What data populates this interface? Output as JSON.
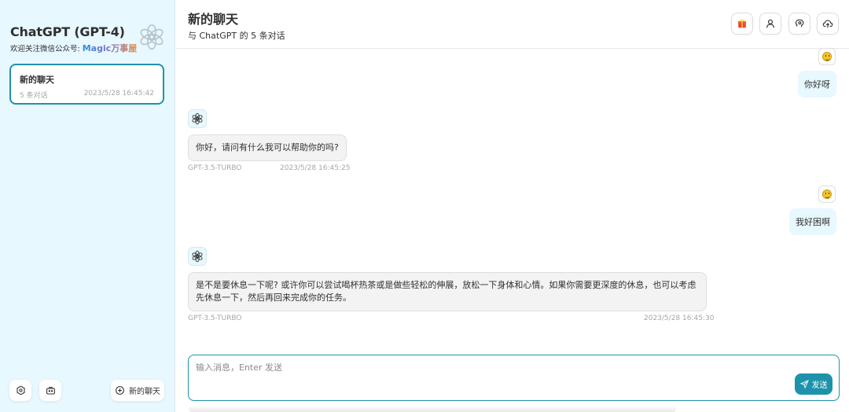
{
  "sidebar": {
    "title": "ChatGPT (GPT-4)",
    "subtitle_prefix": "欢迎关注微信公众号:",
    "subtitle_brand": "Magic万事屋",
    "chats": [
      {
        "title": "新的聊天",
        "count": "5 条对话",
        "time": "2023/5/28 16:45:42"
      }
    ],
    "new_chat_label": "新的聊天"
  },
  "header": {
    "title": "新的聊天",
    "subtitle": "与 ChatGPT 的 5 条对话"
  },
  "messages": [
    {
      "role": "user",
      "text": "你好呀"
    },
    {
      "role": "bot",
      "text": "你好，请问有什么我可以帮助你的吗?",
      "model": "GPT-3.5-TURBO",
      "time": "2023/5/28 16:45:25"
    },
    {
      "role": "user",
      "text": "我好困啊"
    },
    {
      "role": "bot",
      "text": "是不是要休息一下呢? 或许你可以尝试喝杯热茶或是做些轻松的伸展，放松一下身体和心情。如果你需要更深度的休息，也可以考虑先休息一下，然后再回来完成你的任务。",
      "model": "GPT-3.5-TURBO",
      "time": "2023/5/28 16:45:30"
    }
  ],
  "input": {
    "placeholder": "输入消息，Enter 发送",
    "value": "",
    "send_label": "发送"
  },
  "icons": {
    "sidebar_logo": "openai-logo-icon",
    "settings": "settings-icon",
    "mask": "mask-icon",
    "new_chat": "add-circle-icon",
    "gift": "gift-icon",
    "user": "user-icon",
    "brain": "brain-icon",
    "upload": "cloud-upload-icon",
    "send": "send-icon"
  },
  "colors": {
    "accent": "#1d93ab",
    "sidebar_bg": "#e7f8ff",
    "user_bubble": "#e7f8ff",
    "bot_bubble": "#f3f3f3"
  }
}
